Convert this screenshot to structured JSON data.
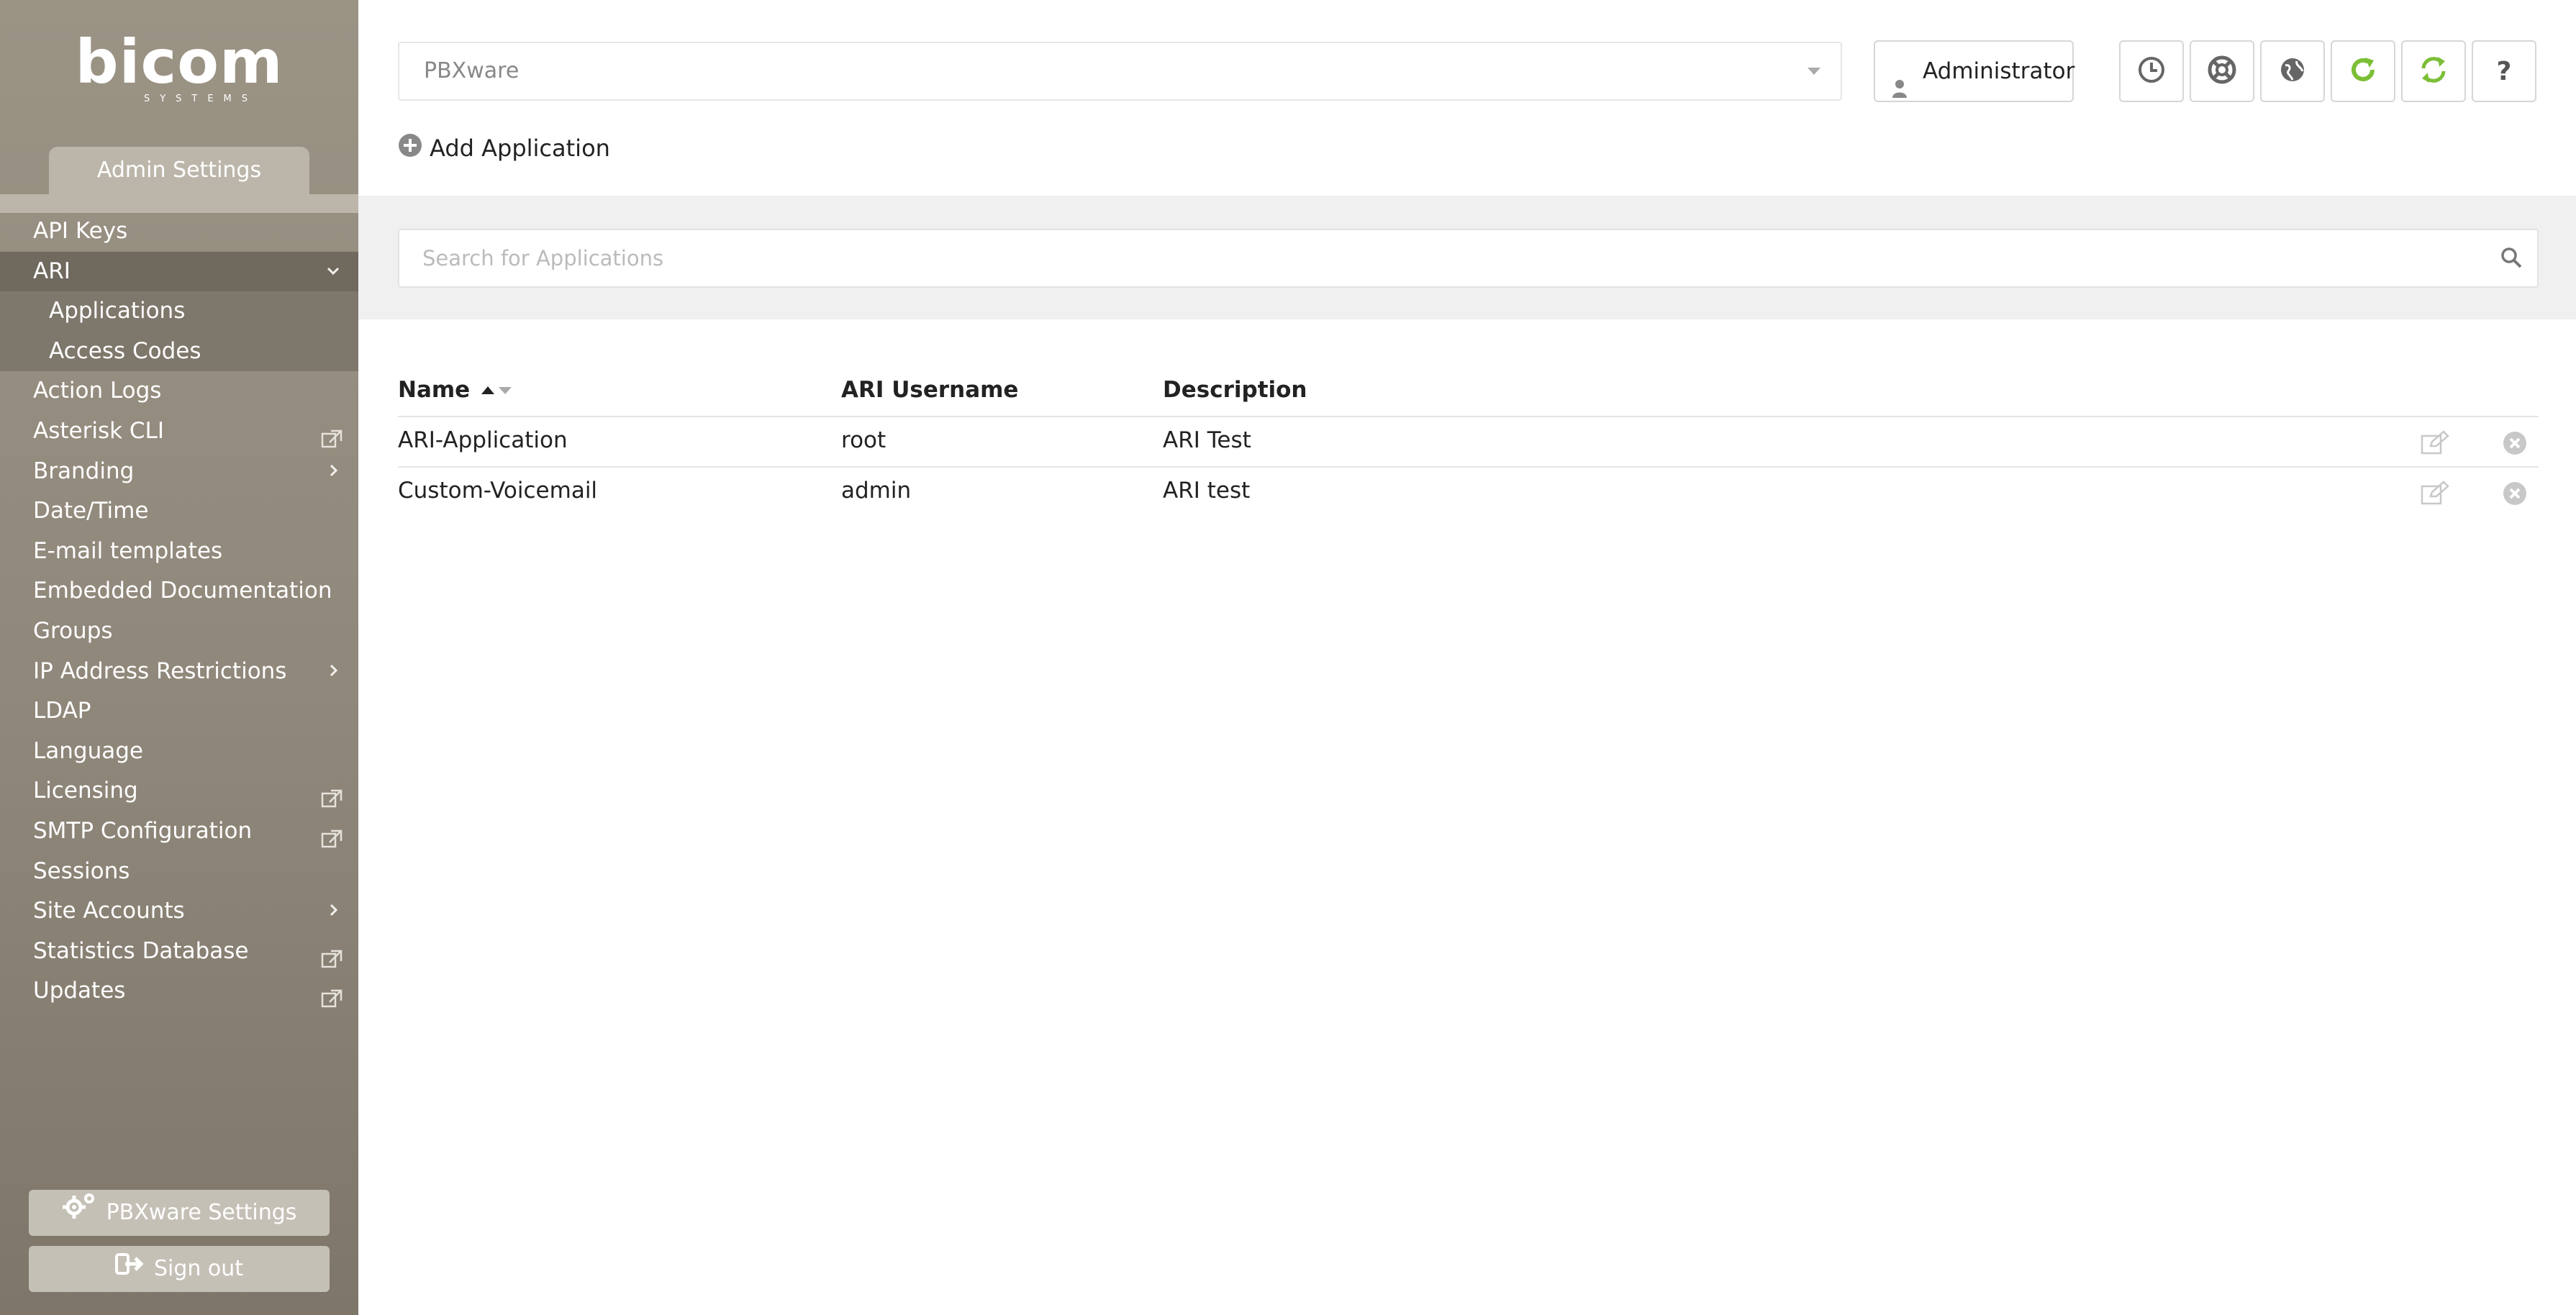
{
  "logo": {
    "word": "bicom",
    "sub": "SYSTEMS"
  },
  "sidebar": {
    "tab_label": "Admin Settings",
    "items": [
      {
        "label": "API Keys",
        "tail": ""
      },
      {
        "label": "ARI",
        "tail": "chevron-down"
      },
      {
        "label": "Applications",
        "tail": ""
      },
      {
        "label": "Access Codes",
        "tail": ""
      },
      {
        "label": "Action Logs",
        "tail": ""
      },
      {
        "label": "Asterisk CLI",
        "tail": "external-link"
      },
      {
        "label": "Branding",
        "tail": "chevron-right"
      },
      {
        "label": "Date/Time",
        "tail": ""
      },
      {
        "label": "E-mail templates",
        "tail": ""
      },
      {
        "label": "Embedded Documentation",
        "tail": ""
      },
      {
        "label": "Groups",
        "tail": ""
      },
      {
        "label": "IP Address Restrictions",
        "tail": "chevron-right"
      },
      {
        "label": "LDAP",
        "tail": ""
      },
      {
        "label": "Language",
        "tail": ""
      },
      {
        "label": "Licensing",
        "tail": "external-link"
      },
      {
        "label": "SMTP Configuration",
        "tail": "external-link"
      },
      {
        "label": "Sessions",
        "tail": ""
      },
      {
        "label": "Site Accounts",
        "tail": "chevron-right"
      },
      {
        "label": "Statistics Database",
        "tail": "external-link"
      },
      {
        "label": "Updates",
        "tail": "external-link"
      }
    ],
    "settings_button": "PBXware Settings",
    "signout_button": "Sign out"
  },
  "header": {
    "select_value": "PBXware",
    "user_button": "Administrator",
    "icons": [
      "clock-icon",
      "lifebuoy-icon",
      "globe-icon",
      "refresh-icon",
      "sync-icon",
      "help-icon"
    ],
    "help_glyph": "?",
    "add_label": "Add Application"
  },
  "search": {
    "placeholder": "Search for Applications",
    "value": ""
  },
  "table": {
    "columns": [
      "Name",
      "ARI Username",
      "Description"
    ],
    "rows": [
      {
        "name": "ARI-Application",
        "username": "root",
        "description": "ARI Test"
      },
      {
        "name": "Custom-Voicemail",
        "username": "admin",
        "description": "ARI test"
      }
    ]
  },
  "colors": {
    "sidebar": "#8f877a",
    "accent_green": "#7cbf36"
  }
}
